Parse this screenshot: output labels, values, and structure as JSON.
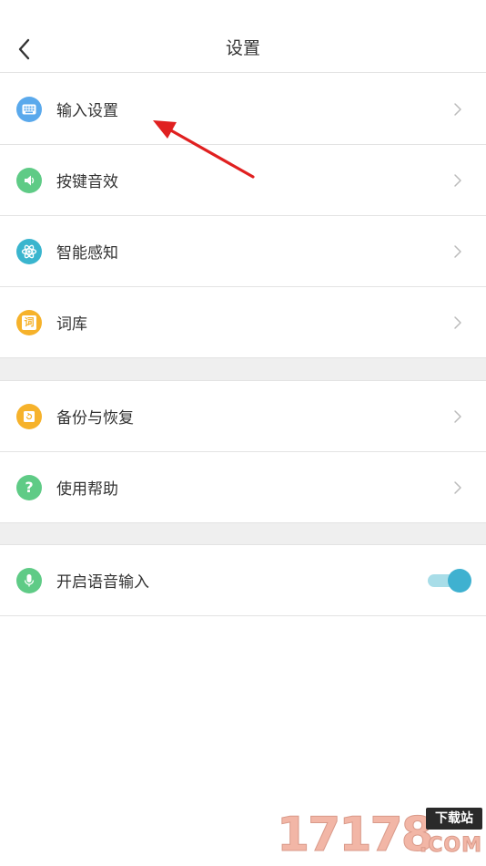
{
  "header": {
    "title": "设置"
  },
  "groups": [
    {
      "items": [
        {
          "label": "输入设置",
          "icon": "keyboard-icon",
          "color": "#5aa9ec"
        },
        {
          "label": "按键音效",
          "icon": "speaker-icon",
          "color": "#5fcb86"
        },
        {
          "label": "智能感知",
          "icon": "atom-icon",
          "color": "#3ab5ce"
        },
        {
          "label": "词库",
          "icon": "dictionary-icon",
          "color": "#f6b22b"
        }
      ]
    },
    {
      "items": [
        {
          "label": "备份与恢复",
          "icon": "backup-icon",
          "color": "#f6b22b"
        },
        {
          "label": "使用帮助",
          "icon": "help-icon",
          "color": "#5fcb86",
          "glyph": "?"
        }
      ]
    },
    {
      "items": [
        {
          "label": "开启语音输入",
          "icon": "microphone-icon",
          "color": "#5fcb86",
          "toggle_on": true
        }
      ]
    }
  ],
  "dictionary_glyph": "词",
  "watermark": {
    "number": "17178",
    "badge": "下载站",
    "suffix": ".COM"
  },
  "colors": {
    "accent": "#3fb1d0",
    "annotation": "#e02020",
    "divider": "#e3e3e3",
    "section_bg": "#efefef"
  }
}
